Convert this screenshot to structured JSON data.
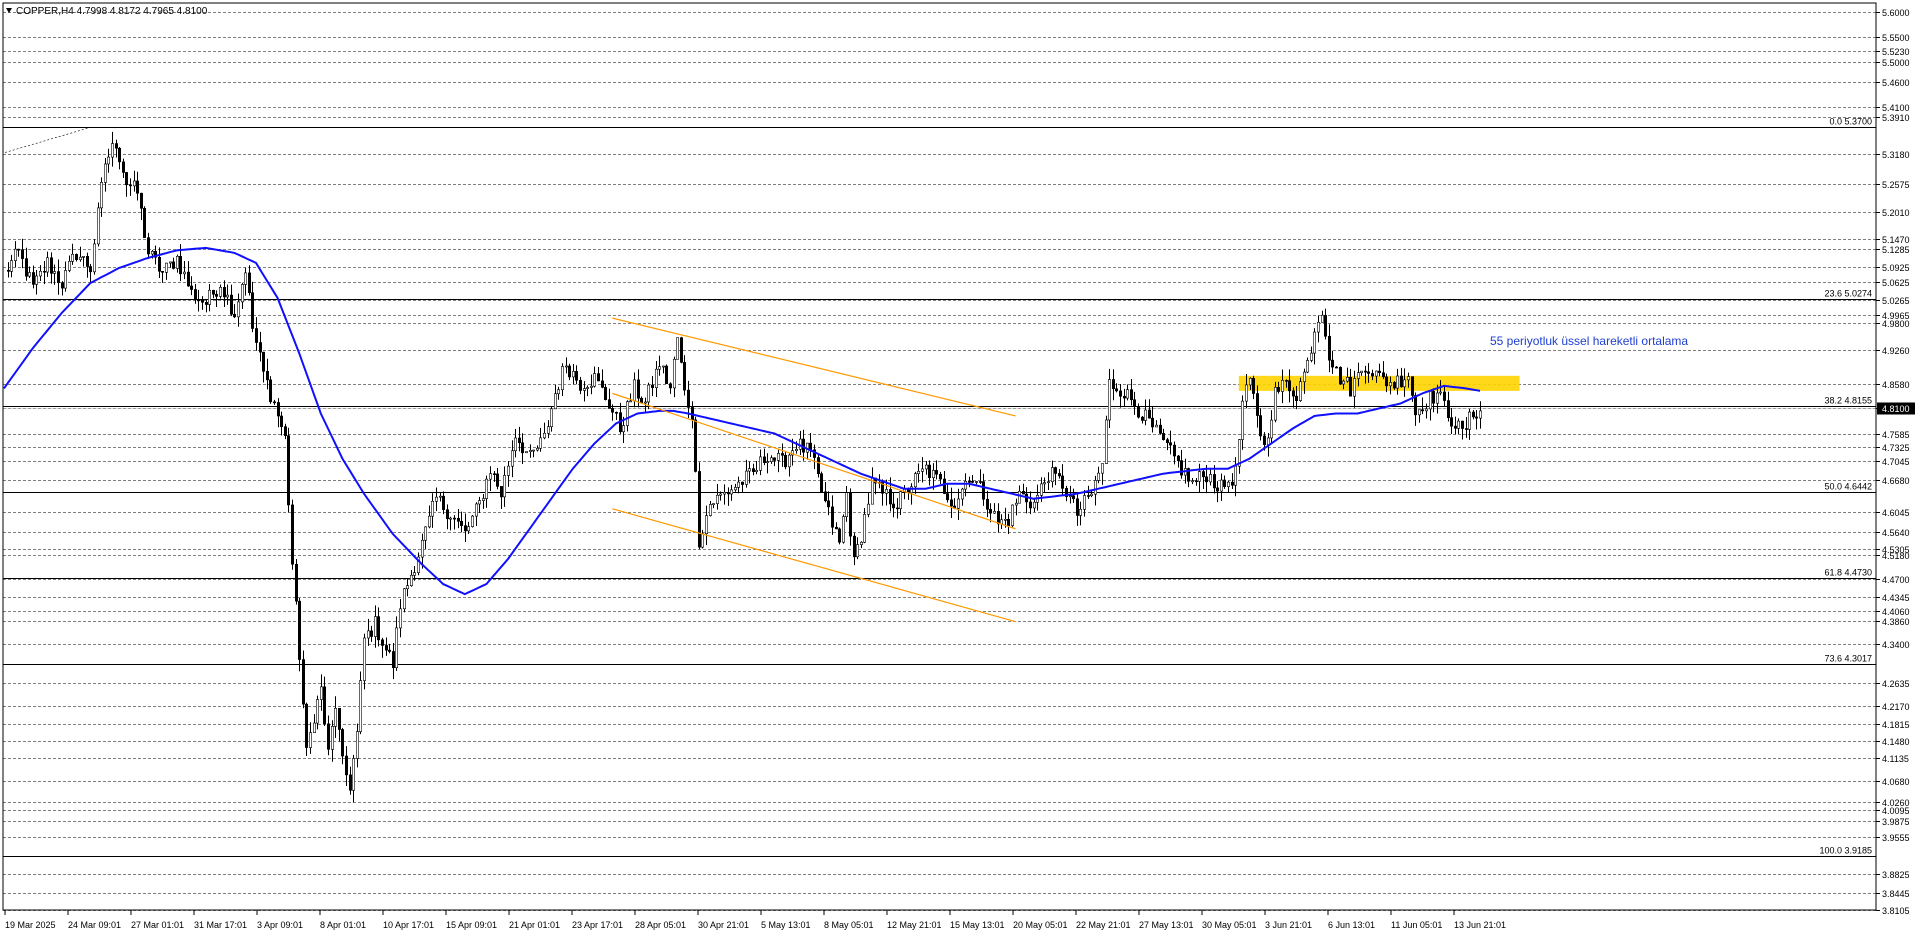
{
  "header": {
    "symbol_line": "COPPER,H4  4.7998 4.8172 4.7965 4.8100"
  },
  "annotation": {
    "text": "55 periyotluk üssel hareketli ortalama",
    "color": "#1f3fd0"
  },
  "colors": {
    "candles": "#000000",
    "ema": "#1010ff",
    "channel": "#ff9900",
    "zone": "#ffd400",
    "background": "#ffffff"
  },
  "chart_data": {
    "type": "candlestick",
    "timeframe": "H4",
    "ylim": [
      3.8105,
      5.6
    ],
    "price_ticks": [
      5.6,
      5.55,
      5.523,
      5.5,
      5.46,
      5.41,
      5.391,
      5.318,
      5.2575,
      5.201,
      5.147,
      5.1285,
      5.0925,
      5.0625,
      5.0265,
      4.9965,
      4.98,
      4.926,
      4.858,
      4.81,
      4.7585,
      4.7325,
      4.7045,
      4.668,
      4.6045,
      4.564,
      4.5305,
      4.518,
      4.47,
      4.4345,
      4.406,
      4.386,
      4.34,
      4.2635,
      4.217,
      4.1815,
      4.148,
      4.1135,
      4.068,
      4.026,
      4.0095,
      3.9875,
      3.9555,
      3.8825,
      3.8445,
      3.8105
    ],
    "price_tick_labels": [
      "5.6000",
      "5.5500",
      "5.5230",
      "5.5000",
      "5.4600",
      "5.4100",
      "5.3910",
      "5.3180",
      "5.2575",
      "5.2010",
      "5.1470",
      "5.1285",
      "5.0925",
      "5.0625",
      "5.0265",
      "4.9965",
      "4.9800",
      "4.9260",
      "4.8580",
      "4.8100",
      "4.7585",
      "4.7325",
      "4.7045",
      "4.6680",
      "4.6045",
      "4.5640",
      "4.5305",
      "4.5180",
      "4.4700",
      "4.4345",
      "4.4060",
      "4.3860",
      "4.3400",
      "4.2635",
      "4.2170",
      "4.1815",
      "4.1480",
      "4.1135",
      "4.0680",
      "4.0260",
      "4.0095",
      "3.9875",
      "3.9555",
      "3.8825",
      "3.8445",
      "3.8105"
    ],
    "current_price": {
      "value": 4.81,
      "label": "4.8100"
    },
    "time_labels": [
      "19 Mar 2025",
      "24 Mar 09:01",
      "27 Mar 01:01",
      "31 Mar 17:01",
      "3 Apr 09:01",
      "8 Apr 01:01",
      "10 Apr 17:01",
      "15 Apr 09:01",
      "21 Apr 01:01",
      "23 Apr 17:01",
      "28 Apr 05:01",
      "30 Apr 21:01",
      "5 May 13:01",
      "8 May 05:01",
      "12 May 21:01",
      "15 May 13:01",
      "20 May 05:01",
      "22 May 21:01",
      "27 May 13:01",
      "30 May 05:01",
      "3 Jun 21:01",
      "6 Jun 13:01",
      "11 Jun 05:01",
      "13 Jun 21:01"
    ],
    "bars_count": 520,
    "fibonacci": {
      "time_anchor": "24 Mar 09:01",
      "levels": [
        {
          "label": "0.0 5.3700",
          "price": 5.37
        },
        {
          "label": "23.6 5.0274",
          "price": 5.0274
        },
        {
          "label": "38.2 4.8155",
          "price": 4.8155
        },
        {
          "label": "50.0 4.6442",
          "price": 4.6442
        },
        {
          "label": "61.8 4.4730",
          "price": 4.473
        },
        {
          "label": "73.6 4.3017",
          "price": 4.3017
        },
        {
          "label": "100.0 3.9185",
          "price": 3.9185
        }
      ]
    },
    "channel_lines": [
      {
        "start_bar": 169,
        "start_price": 4.99,
        "end_bar": 281,
        "end_price": 4.795
      },
      {
        "start_bar": 169,
        "start_price": 4.84,
        "end_bar": 281,
        "end_price": 4.57
      },
      {
        "start_bar": 169,
        "start_price": 4.61,
        "end_bar": 281,
        "end_price": 4.385
      }
    ],
    "zone": {
      "start_bar": 343,
      "end_bar": 421,
      "top": 4.875,
      "bottom": 4.845
    },
    "anchors": [
      [
        0,
        5.08
      ],
      [
        4,
        5.12
      ],
      [
        8,
        5.05
      ],
      [
        12,
        5.1
      ],
      [
        16,
        5.06
      ],
      [
        20,
        5.12
      ],
      [
        24,
        5.09
      ],
      [
        28,
        5.3
      ],
      [
        31,
        5.34
      ],
      [
        34,
        5.26
      ],
      [
        37,
        5.24
      ],
      [
        40,
        5.12
      ],
      [
        44,
        5.08
      ],
      [
        48,
        5.11
      ],
      [
        52,
        5.04
      ],
      [
        56,
        5.02
      ],
      [
        60,
        5.06
      ],
      [
        64,
        5.0
      ],
      [
        67,
        5.09
      ],
      [
        69,
        4.97
      ],
      [
        72,
        4.88
      ],
      [
        75,
        4.82
      ],
      [
        78,
        4.75
      ],
      [
        80,
        4.5
      ],
      [
        82,
        4.32
      ],
      [
        84,
        4.12
      ],
      [
        86,
        4.2
      ],
      [
        88,
        4.25
      ],
      [
        90,
        4.12
      ],
      [
        92,
        4.22
      ],
      [
        94,
        4.1
      ],
      [
        96,
        4.06
      ],
      [
        98,
        4.16
      ],
      [
        100,
        4.35
      ],
      [
        103,
        4.38
      ],
      [
        106,
        4.33
      ],
      [
        108,
        4.3
      ],
      [
        110,
        4.42
      ],
      [
        113,
        4.48
      ],
      [
        116,
        4.54
      ],
      [
        120,
        4.63
      ],
      [
        124,
        4.6
      ],
      [
        128,
        4.56
      ],
      [
        132,
        4.62
      ],
      [
        135,
        4.69
      ],
      [
        138,
        4.64
      ],
      [
        142,
        4.76
      ],
      [
        146,
        4.71
      ],
      [
        150,
        4.75
      ],
      [
        153,
        4.84
      ],
      [
        156,
        4.9
      ],
      [
        160,
        4.86
      ],
      [
        164,
        4.87
      ],
      [
        168,
        4.82
      ],
      [
        171,
        4.77
      ],
      [
        175,
        4.85
      ],
      [
        178,
        4.82
      ],
      [
        182,
        4.9
      ],
      [
        185,
        4.85
      ],
      [
        187,
        4.95
      ],
      [
        189,
        4.84
      ],
      [
        191,
        4.8
      ],
      [
        193,
        4.55
      ],
      [
        196,
        4.62
      ],
      [
        200,
        4.64
      ],
      [
        204,
        4.66
      ],
      [
        208,
        4.68
      ],
      [
        212,
        4.72
      ],
      [
        216,
        4.7
      ],
      [
        220,
        4.74
      ],
      [
        224,
        4.72
      ],
      [
        228,
        4.62
      ],
      [
        232,
        4.54
      ],
      [
        234,
        4.64
      ],
      [
        236,
        4.5
      ],
      [
        238,
        4.56
      ],
      [
        241,
        4.66
      ],
      [
        244,
        4.64
      ],
      [
        248,
        4.62
      ],
      [
        252,
        4.66
      ],
      [
        256,
        4.69
      ],
      [
        260,
        4.66
      ],
      [
        264,
        4.62
      ],
      [
        268,
        4.68
      ],
      [
        272,
        4.64
      ],
      [
        276,
        4.58
      ],
      [
        279,
        4.59
      ],
      [
        282,
        4.64
      ],
      [
        286,
        4.62
      ],
      [
        290,
        4.68
      ],
      [
        294,
        4.66
      ],
      [
        298,
        4.6
      ],
      [
        302,
        4.64
      ],
      [
        305,
        4.7
      ],
      [
        307,
        4.86
      ],
      [
        310,
        4.85
      ],
      [
        314,
        4.82
      ],
      [
        318,
        4.78
      ],
      [
        322,
        4.74
      ],
      [
        326,
        4.7
      ],
      [
        330,
        4.66
      ],
      [
        334,
        4.68
      ],
      [
        338,
        4.65
      ],
      [
        342,
        4.68
      ],
      [
        344,
        4.82
      ],
      [
        346,
        4.86
      ],
      [
        348,
        4.8
      ],
      [
        350,
        4.73
      ],
      [
        353,
        4.84
      ],
      [
        356,
        4.86
      ],
      [
        359,
        4.84
      ],
      [
        362,
        4.9
      ],
      [
        364,
        4.97
      ],
      [
        366,
        5.01
      ],
      [
        368,
        4.92
      ],
      [
        370,
        4.88
      ],
      [
        374,
        4.85
      ],
      [
        378,
        4.9
      ],
      [
        382,
        4.87
      ],
      [
        386,
        4.86
      ],
      [
        390,
        4.88
      ],
      [
        392,
        4.8
      ],
      [
        394,
        4.82
      ],
      [
        398,
        4.84
      ],
      [
        402,
        4.79
      ],
      [
        405,
        4.76
      ],
      [
        408,
        4.8
      ],
      [
        410,
        4.81
      ]
    ],
    "ema_period": 55,
    "ema_anchors": [
      [
        0,
        4.85
      ],
      [
        8,
        4.93
      ],
      [
        16,
        5.0
      ],
      [
        24,
        5.06
      ],
      [
        32,
        5.09
      ],
      [
        40,
        5.11
      ],
      [
        48,
        5.125
      ],
      [
        56,
        5.13
      ],
      [
        64,
        5.12
      ],
      [
        70,
        5.1
      ],
      [
        76,
        5.03
      ],
      [
        82,
        4.92
      ],
      [
        88,
        4.8
      ],
      [
        94,
        4.71
      ],
      [
        100,
        4.64
      ],
      [
        108,
        4.56
      ],
      [
        116,
        4.5
      ],
      [
        122,
        4.46
      ],
      [
        128,
        4.44
      ],
      [
        134,
        4.46
      ],
      [
        140,
        4.51
      ],
      [
        146,
        4.57
      ],
      [
        152,
        4.63
      ],
      [
        158,
        4.69
      ],
      [
        164,
        4.74
      ],
      [
        170,
        4.78
      ],
      [
        176,
        4.8
      ],
      [
        182,
        4.805
      ],
      [
        186,
        4.805
      ],
      [
        190,
        4.8
      ],
      [
        196,
        4.79
      ],
      [
        202,
        4.78
      ],
      [
        208,
        4.77
      ],
      [
        214,
        4.76
      ],
      [
        220,
        4.74
      ],
      [
        226,
        4.72
      ],
      [
        232,
        4.7
      ],
      [
        238,
        4.68
      ],
      [
        244,
        4.665
      ],
      [
        250,
        4.65
      ],
      [
        256,
        4.65
      ],
      [
        262,
        4.66
      ],
      [
        268,
        4.66
      ],
      [
        274,
        4.65
      ],
      [
        280,
        4.64
      ],
      [
        286,
        4.63
      ],
      [
        292,
        4.635
      ],
      [
        298,
        4.64
      ],
      [
        304,
        4.65
      ],
      [
        310,
        4.66
      ],
      [
        316,
        4.67
      ],
      [
        322,
        4.68
      ],
      [
        328,
        4.685
      ],
      [
        334,
        4.69
      ],
      [
        340,
        4.69
      ],
      [
        346,
        4.71
      ],
      [
        352,
        4.74
      ],
      [
        358,
        4.77
      ],
      [
        364,
        4.795
      ],
      [
        370,
        4.8
      ],
      [
        376,
        4.8
      ],
      [
        382,
        4.81
      ],
      [
        388,
        4.82
      ],
      [
        394,
        4.84
      ],
      [
        400,
        4.855
      ],
      [
        406,
        4.85
      ],
      [
        410,
        4.845
      ]
    ]
  }
}
